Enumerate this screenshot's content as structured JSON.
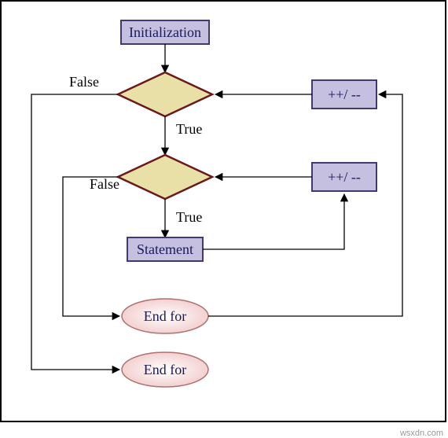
{
  "nodes": {
    "init_label": "Initialization",
    "outer_inc_label": "++/ --",
    "inner_inc_label": "++/ --",
    "stmt_label": "Statement",
    "end_outer_label": "End for",
    "end_inner_label": "End for"
  },
  "edge_labels": {
    "outer_false": "False",
    "outer_true": "True",
    "inner_false": "False",
    "inner_true": "True"
  },
  "watermark": "wsxdn.com",
  "colors": {
    "rect_fill": "#c5c0e0",
    "rect_stroke": "#3f3b70",
    "diamond_fill": "#e9e0a8",
    "diamond_stroke": "#6a1a1a",
    "oval_fill_center": "#ffffff",
    "oval_fill_edge": "#f0c7c7",
    "oval_stroke": "#b07070"
  }
}
